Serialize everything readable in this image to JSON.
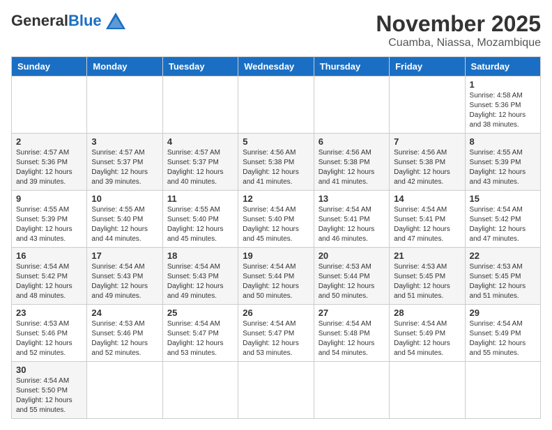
{
  "header": {
    "logo_general": "General",
    "logo_blue": "Blue",
    "month_title": "November 2025",
    "location": "Cuamba, Niassa, Mozambique"
  },
  "weekdays": [
    "Sunday",
    "Monday",
    "Tuesday",
    "Wednesday",
    "Thursday",
    "Friday",
    "Saturday"
  ],
  "weeks": [
    [
      {
        "day": "",
        "info": ""
      },
      {
        "day": "",
        "info": ""
      },
      {
        "day": "",
        "info": ""
      },
      {
        "day": "",
        "info": ""
      },
      {
        "day": "",
        "info": ""
      },
      {
        "day": "",
        "info": ""
      },
      {
        "day": "1",
        "info": "Sunrise: 4:58 AM\nSunset: 5:36 PM\nDaylight: 12 hours and 38 minutes."
      }
    ],
    [
      {
        "day": "2",
        "info": "Sunrise: 4:57 AM\nSunset: 5:36 PM\nDaylight: 12 hours and 39 minutes."
      },
      {
        "day": "3",
        "info": "Sunrise: 4:57 AM\nSunset: 5:37 PM\nDaylight: 12 hours and 39 minutes."
      },
      {
        "day": "4",
        "info": "Sunrise: 4:57 AM\nSunset: 5:37 PM\nDaylight: 12 hours and 40 minutes."
      },
      {
        "day": "5",
        "info": "Sunrise: 4:56 AM\nSunset: 5:38 PM\nDaylight: 12 hours and 41 minutes."
      },
      {
        "day": "6",
        "info": "Sunrise: 4:56 AM\nSunset: 5:38 PM\nDaylight: 12 hours and 41 minutes."
      },
      {
        "day": "7",
        "info": "Sunrise: 4:56 AM\nSunset: 5:38 PM\nDaylight: 12 hours and 42 minutes."
      },
      {
        "day": "8",
        "info": "Sunrise: 4:55 AM\nSunset: 5:39 PM\nDaylight: 12 hours and 43 minutes."
      }
    ],
    [
      {
        "day": "9",
        "info": "Sunrise: 4:55 AM\nSunset: 5:39 PM\nDaylight: 12 hours and 43 minutes."
      },
      {
        "day": "10",
        "info": "Sunrise: 4:55 AM\nSunset: 5:40 PM\nDaylight: 12 hours and 44 minutes."
      },
      {
        "day": "11",
        "info": "Sunrise: 4:55 AM\nSunset: 5:40 PM\nDaylight: 12 hours and 45 minutes."
      },
      {
        "day": "12",
        "info": "Sunrise: 4:54 AM\nSunset: 5:40 PM\nDaylight: 12 hours and 45 minutes."
      },
      {
        "day": "13",
        "info": "Sunrise: 4:54 AM\nSunset: 5:41 PM\nDaylight: 12 hours and 46 minutes."
      },
      {
        "day": "14",
        "info": "Sunrise: 4:54 AM\nSunset: 5:41 PM\nDaylight: 12 hours and 47 minutes."
      },
      {
        "day": "15",
        "info": "Sunrise: 4:54 AM\nSunset: 5:42 PM\nDaylight: 12 hours and 47 minutes."
      }
    ],
    [
      {
        "day": "16",
        "info": "Sunrise: 4:54 AM\nSunset: 5:42 PM\nDaylight: 12 hours and 48 minutes."
      },
      {
        "day": "17",
        "info": "Sunrise: 4:54 AM\nSunset: 5:43 PM\nDaylight: 12 hours and 49 minutes."
      },
      {
        "day": "18",
        "info": "Sunrise: 4:54 AM\nSunset: 5:43 PM\nDaylight: 12 hours and 49 minutes."
      },
      {
        "day": "19",
        "info": "Sunrise: 4:54 AM\nSunset: 5:44 PM\nDaylight: 12 hours and 50 minutes."
      },
      {
        "day": "20",
        "info": "Sunrise: 4:53 AM\nSunset: 5:44 PM\nDaylight: 12 hours and 50 minutes."
      },
      {
        "day": "21",
        "info": "Sunrise: 4:53 AM\nSunset: 5:45 PM\nDaylight: 12 hours and 51 minutes."
      },
      {
        "day": "22",
        "info": "Sunrise: 4:53 AM\nSunset: 5:45 PM\nDaylight: 12 hours and 51 minutes."
      }
    ],
    [
      {
        "day": "23",
        "info": "Sunrise: 4:53 AM\nSunset: 5:46 PM\nDaylight: 12 hours and 52 minutes."
      },
      {
        "day": "24",
        "info": "Sunrise: 4:53 AM\nSunset: 5:46 PM\nDaylight: 12 hours and 52 minutes."
      },
      {
        "day": "25",
        "info": "Sunrise: 4:54 AM\nSunset: 5:47 PM\nDaylight: 12 hours and 53 minutes."
      },
      {
        "day": "26",
        "info": "Sunrise: 4:54 AM\nSunset: 5:47 PM\nDaylight: 12 hours and 53 minutes."
      },
      {
        "day": "27",
        "info": "Sunrise: 4:54 AM\nSunset: 5:48 PM\nDaylight: 12 hours and 54 minutes."
      },
      {
        "day": "28",
        "info": "Sunrise: 4:54 AM\nSunset: 5:49 PM\nDaylight: 12 hours and 54 minutes."
      },
      {
        "day": "29",
        "info": "Sunrise: 4:54 AM\nSunset: 5:49 PM\nDaylight: 12 hours and 55 minutes."
      }
    ],
    [
      {
        "day": "30",
        "info": "Sunrise: 4:54 AM\nSunset: 5:50 PM\nDaylight: 12 hours and 55 minutes."
      },
      {
        "day": "",
        "info": ""
      },
      {
        "day": "",
        "info": ""
      },
      {
        "day": "",
        "info": ""
      },
      {
        "day": "",
        "info": ""
      },
      {
        "day": "",
        "info": ""
      },
      {
        "day": "",
        "info": ""
      }
    ]
  ]
}
